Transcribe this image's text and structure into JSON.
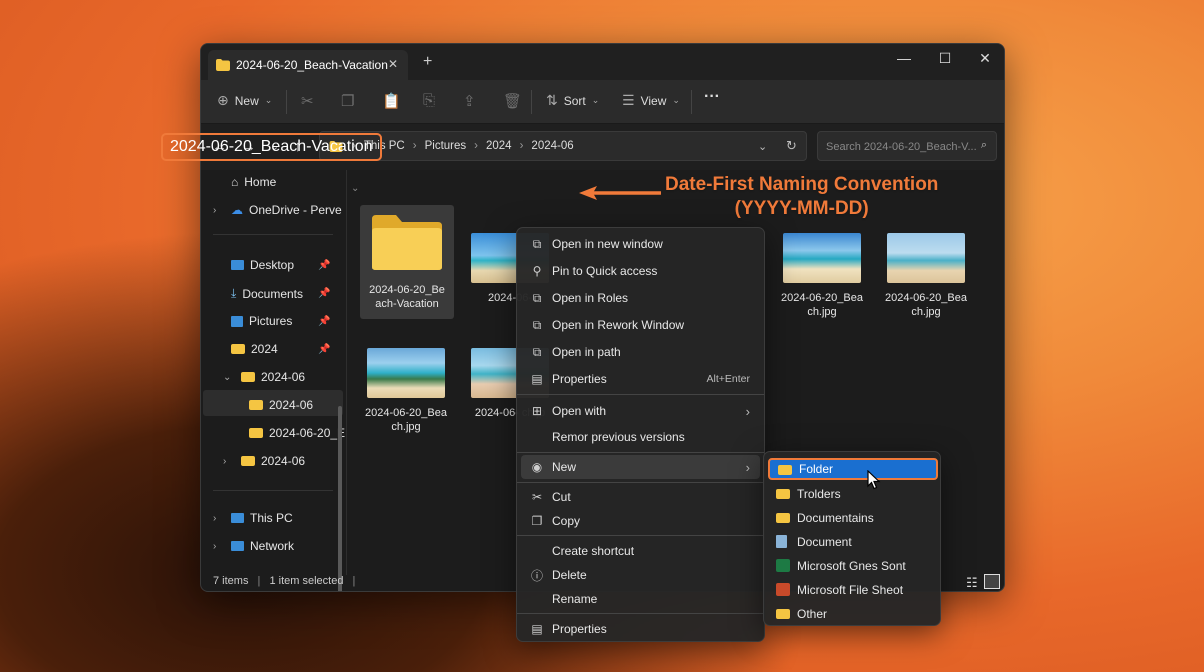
{
  "window": {
    "tab_title": "2024-06-20_Beach-Vacation",
    "tab_close": "✕",
    "new_tab": "+",
    "minimize": "—",
    "maximize": "☐",
    "close": "✕"
  },
  "toolbar": {
    "new_label": "New",
    "sort_label": "Sort",
    "view_label": "View",
    "more": "···"
  },
  "address": {
    "crumbs": [
      "This PC",
      "Pictures",
      "2024",
      "2024-06"
    ],
    "search_placeholder": "Search 2024-06-20_Beach-V..."
  },
  "sidebar": {
    "home": "Home",
    "onedrive": "OneDrive - Perve",
    "desktop": "Desktop",
    "documents": "Documents",
    "pictures": "Pictures",
    "f2024": "2024",
    "f202406": "2024-06",
    "f202406_sel": "2024-06",
    "f20240620": "2024-06-20_E",
    "f202406b": "2024-06",
    "thispc": "This PC",
    "network": "Network"
  },
  "status": {
    "items": "7 items",
    "selected": "1 item selected"
  },
  "content": {
    "folder_title": "2024-06-20_Beach-Vacation",
    "tiles": [
      {
        "label": "2024-06-20_Be ach-Vacation"
      },
      {
        "label": "2024-06-"
      },
      {
        "label": "2024-06-20_Bea ch.jpg"
      },
      {
        "label": "2024-06-20_Bea ch.jpg"
      },
      {
        "label": "2024-06-20_Bea ch.jpg"
      },
      {
        "label": "2024-06- ch.jp"
      }
    ]
  },
  "annotation": {
    "line1": "Date-First Naming Convention",
    "line2": "(YYYY-MM-DD)"
  },
  "context_menu": {
    "open_new_window": "Open in new window",
    "pin_quick": "Pin to Quick access",
    "open_roles": "Open in Roles",
    "open_rework": "Open in Rework Window",
    "open_path": "Open in path",
    "properties_top": "Properties",
    "properties_accel": "Alt+Enter",
    "open_with": "Open with",
    "remor": "Remor previous versions",
    "new": "New",
    "cut": "Cut",
    "copy": "Copy",
    "create_shortcut": "Create shortcut",
    "delete": "Delete",
    "rename": "Rename",
    "properties_bottom": "Properties"
  },
  "submenu": {
    "folder": "Folder",
    "trolders": "Trolders",
    "documentains": "Documentains",
    "document": "Document",
    "ms_ghes": "Microsoft Gnes Sont",
    "ms_file": "Microsoft File Sheot",
    "other": "Other"
  },
  "colors": {
    "accent": "#f07a3a",
    "selection_blue": "#1a6fd0",
    "folder_yellow": "#f5c542"
  }
}
